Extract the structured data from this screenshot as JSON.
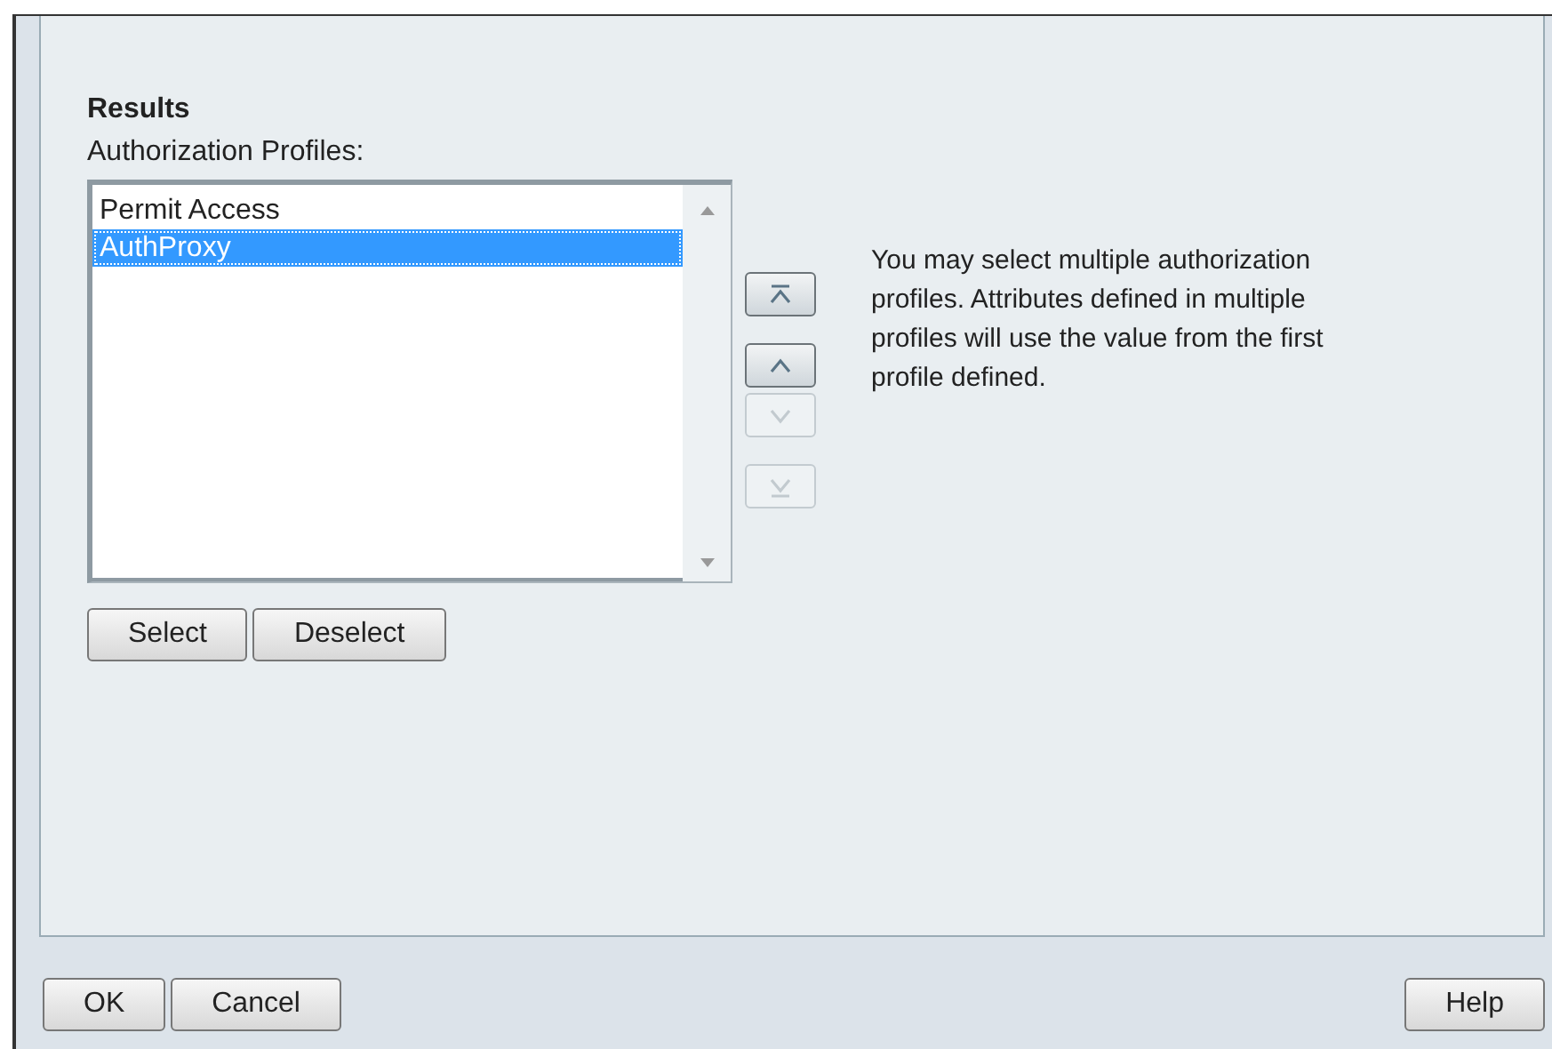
{
  "section": {
    "title": "Results",
    "label": "Authorization Profiles:"
  },
  "profiles": [
    {
      "label": "Permit Access",
      "selected": false
    },
    {
      "label": "AuthProxy",
      "selected": true
    }
  ],
  "move_buttons": [
    {
      "kind": "top",
      "disabled": false
    },
    {
      "kind": "up",
      "disabled": false
    },
    {
      "kind": "down",
      "disabled": true
    },
    {
      "kind": "bottom",
      "disabled": true
    }
  ],
  "list_buttons": [
    "Select",
    "Deselect"
  ],
  "hint": "You may select multiple authorization profiles. Attributes defined in multiple profiles will use the value from the first profile defined.",
  "footer": {
    "left_buttons": [
      "OK",
      "Cancel"
    ],
    "right_buttons": [
      "Help"
    ]
  }
}
